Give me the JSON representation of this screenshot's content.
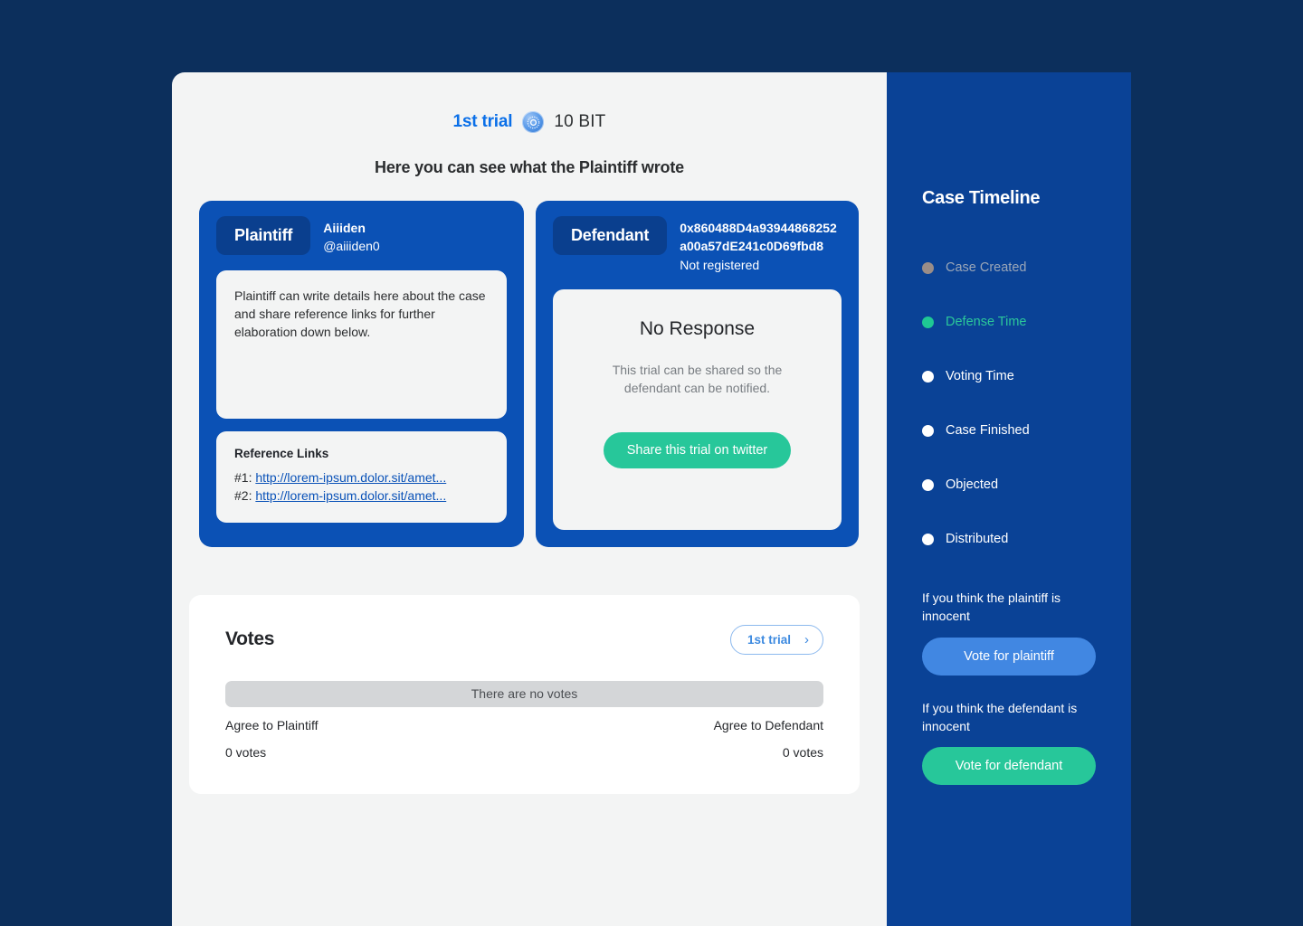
{
  "theme": {
    "page_bg": "#0c2f5c",
    "main_bg": "#f3f4f4",
    "card_blue": "#0b51b5",
    "badge_blue": "#0a3f8e",
    "sidebar_blue": "#0a4296",
    "accent_green": "#27c79a",
    "accent_blue": "#0a6fe8",
    "vote_plaintiff_blue": "#4187e2"
  },
  "header": {
    "trial_label": "1st trial",
    "bit_icon": "bit-token-icon",
    "bit_amount": "10 BIT",
    "subtitle": "Here you can see what the Plaintiff wrote"
  },
  "plaintiff": {
    "badge": "Plaintiff",
    "name": "Aiiiden",
    "handle": "@aiiiden0",
    "statement": "Plaintiff can write details here about the case and share reference links for further elaboration down below.",
    "reference_links_title": "Reference Links",
    "links": [
      {
        "index": "#1:",
        "url": "http://lorem-ipsum.dolor.sit/amet..."
      },
      {
        "index": "#2:",
        "url": "http://lorem-ipsum.dolor.sit/amet..."
      }
    ]
  },
  "defendant": {
    "badge": "Defendant",
    "address": "0x860488D4a93944868252a00a57dE241c0D69fbd8",
    "status": "Not registered",
    "no_response_title": "No Response",
    "no_response_body": "This trial can be shared so the defendant can be notified.",
    "share_button": "Share this trial on twitter"
  },
  "votes": {
    "title": "Votes",
    "trial_pill": "1st trial",
    "chevron": "›",
    "empty_bar_text": "There are no votes",
    "left_label": "Agree to Plaintiff",
    "left_count": "0 votes",
    "right_label": "Agree to Defendant",
    "right_count": "0 votes"
  },
  "sidebar": {
    "title": "Case Timeline",
    "timeline": [
      {
        "label": "Case Created",
        "state": "done"
      },
      {
        "label": "Defense Time",
        "state": "active"
      },
      {
        "label": "Voting Time",
        "state": "pending"
      },
      {
        "label": "Case Finished",
        "state": "pending"
      },
      {
        "label": "Objected",
        "state": "pending"
      },
      {
        "label": "Distributed",
        "state": "pending"
      }
    ],
    "plaintiff_hint": "If you think the plaintiff is innocent",
    "plaintiff_button": "Vote for plaintiff",
    "defendant_hint": "If you think the defendant is innocent",
    "defendant_button": "Vote for defendant"
  }
}
